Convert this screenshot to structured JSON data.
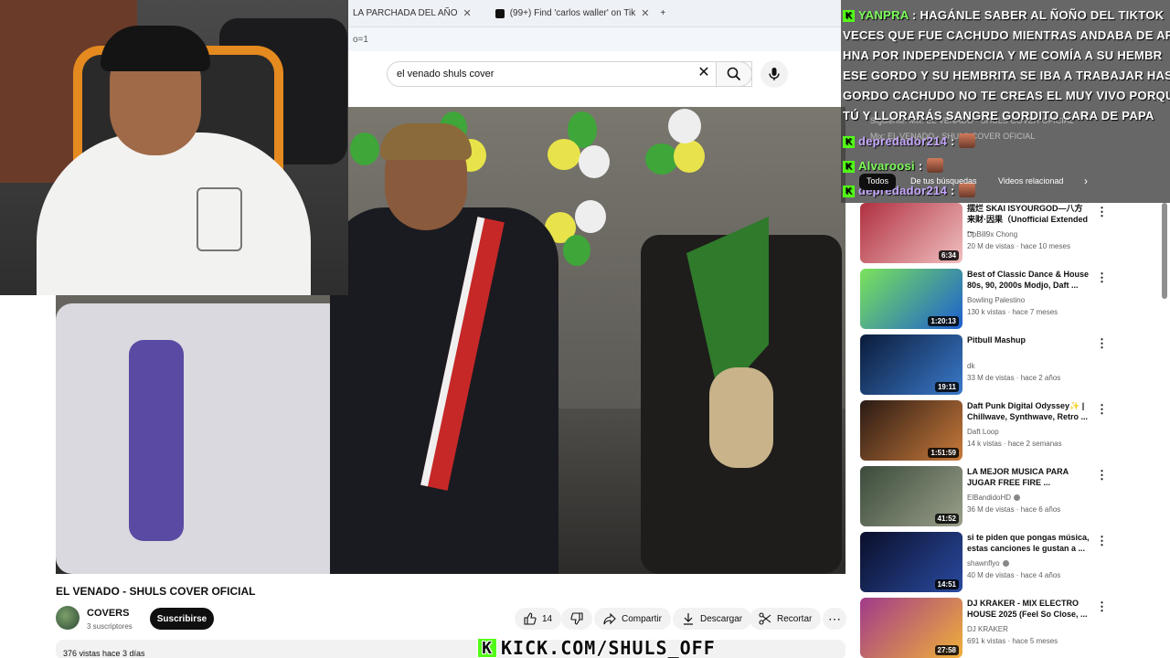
{
  "browser": {
    "tabs": [
      {
        "label": "LA PARCHADA DEL AÑO"
      },
      {
        "label": "(99+) Find 'carlos waller' on Tik"
      }
    ],
    "url_fragment": "o=1"
  },
  "search": {
    "query": "el venado shuls cover"
  },
  "video": {
    "title": "EL VENADO - SHULS COVER OFICIAL",
    "channel": "COVERS",
    "subscribers": "3 suscriptores",
    "subscribe_label": "Suscribirse",
    "likes": "14",
    "share_label": "Compartir",
    "download_label": "Descargar",
    "clip_label": "Recortar",
    "views_date": "376 vistas  hace 3 días"
  },
  "overlay": {
    "kick_url": "KICK.COM/SHULS_OFF"
  },
  "chat": {
    "messages": [
      {
        "user": "YANPRA",
        "text": "HAGÁNLE SABER AL ÑOÑO DEL TIKTOK"
      },
      {
        "user": "",
        "text": "VECES QUE FUE CACHUDO MIENTRAS ANDABA DE AF"
      },
      {
        "user": "",
        "text": "HNA POR INDEPENDENCIA Y ME COMÍA A SU HEMBR"
      },
      {
        "user": "",
        "text": "ESE GORDO Y SU HEMBRITA SE IBA A TRABAJAR HAS"
      },
      {
        "user": "",
        "text": "GORDO CACHUDO NO TE CREAS EL MUY VIVO PORQU"
      },
      {
        "user": "",
        "text": "TÚ Y LLORARÁS SANGRE GORDITO CARA DE PAPA"
      },
      {
        "user": "depredador214",
        "text": ":"
      },
      {
        "user": "Alvaroosi",
        "text": ":"
      },
      {
        "user": "depredador214",
        "text": ":"
      }
    ],
    "ghost_next": "Siguiente: Mix: EL VENADO - SHULS COVER OFICIAL",
    "ghost_mix": "Mix: EL VENADO - SHULS COVER OFICIAL"
  },
  "filters": {
    "chips": [
      "Todos",
      "De tus búsquedas",
      "Videos relacionad"
    ]
  },
  "recommendations": [
    {
      "title": "摆烂 SKAI ISYOURGOD—八方来财·因果（Unofficial Extended ...",
      "channel": "DpBill9x Chong",
      "meta": "20 M de vistas · hace 10 meses",
      "duration": "6:34",
      "verified": false,
      "colors": [
        "#b03040",
        "#f0c0c0"
      ]
    },
    {
      "title": "Best of Classic Dance & House 80s, 90, 2000s Modjo, Daft ...",
      "channel": "Bowling Palestino",
      "meta": "130 k vistas · hace 7 meses",
      "duration": "1:20:13",
      "verified": false,
      "colors": [
        "#7be35a",
        "#1c5fd0"
      ]
    },
    {
      "title": "Pitbull Mashup",
      "channel": "dk",
      "meta": "33 M de vistas · hace 2 años",
      "duration": "19:11",
      "verified": false,
      "colors": [
        "#0b1b3a",
        "#3a7acb"
      ]
    },
    {
      "title": "Daft Punk Digital Odyssey✨ | Chillwave, Synthwave, Retro ...",
      "channel": "Daft Loop",
      "meta": "14 k vistas · hace 2 semanas",
      "duration": "1:51:59",
      "verified": false,
      "colors": [
        "#2a1a14",
        "#c87a3a"
      ]
    },
    {
      "title": "LA MEJOR MUSICA PARA JUGAR FREE FIRE ...",
      "channel": "ElBandidoHD",
      "meta": "36 M de vistas · hace 6 años",
      "duration": "41:52",
      "verified": true,
      "colors": [
        "#3a4a3a",
        "#9aa08a"
      ]
    },
    {
      "title": "si te piden que pongas música, estas canciones le gustan a ...",
      "channel": "shawnflyo",
      "meta": "40 M de vistas · hace 4 años",
      "duration": "14:51",
      "verified": true,
      "colors": [
        "#0a0f2a",
        "#2a4aa0"
      ]
    },
    {
      "title": "DJ KRAKER - MIX ELECTRO HOUSE 2025 (Feel So Close, ...",
      "channel": "DJ KRAKER",
      "meta": "691 k vistas · hace 5 meses",
      "duration": "27:58",
      "verified": false,
      "colors": [
        "#a03a8a",
        "#f0b03a"
      ]
    }
  ]
}
